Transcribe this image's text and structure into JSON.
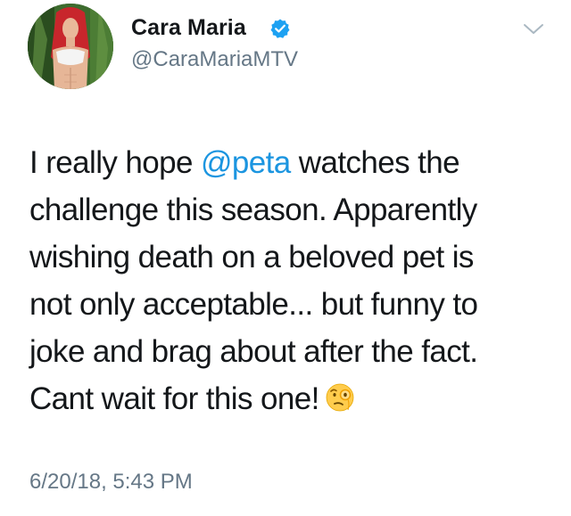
{
  "author": {
    "display_name": "Cara Maria",
    "handle": "@CaraMariaMTV",
    "verified": true
  },
  "tweet": {
    "lines": [
      {
        "before": "I really hope ",
        "mention": "@peta",
        "after": " watches the"
      },
      {
        "text": "challenge this season. Apparently"
      },
      {
        "text": "wishing death on a beloved pet is"
      },
      {
        "text": "not only acceptable... but funny to"
      },
      {
        "text": "joke and brag about after the fact."
      },
      {
        "text": "Cant wait for this one!"
      }
    ],
    "emoji": "face-with-monocle-icon",
    "timestamp": "6/20/18, 5:43 PM"
  },
  "colors": {
    "text": "#14171a",
    "secondary": "#657786",
    "link": "#1b95e0",
    "verified_badge": "#1da1f2"
  }
}
